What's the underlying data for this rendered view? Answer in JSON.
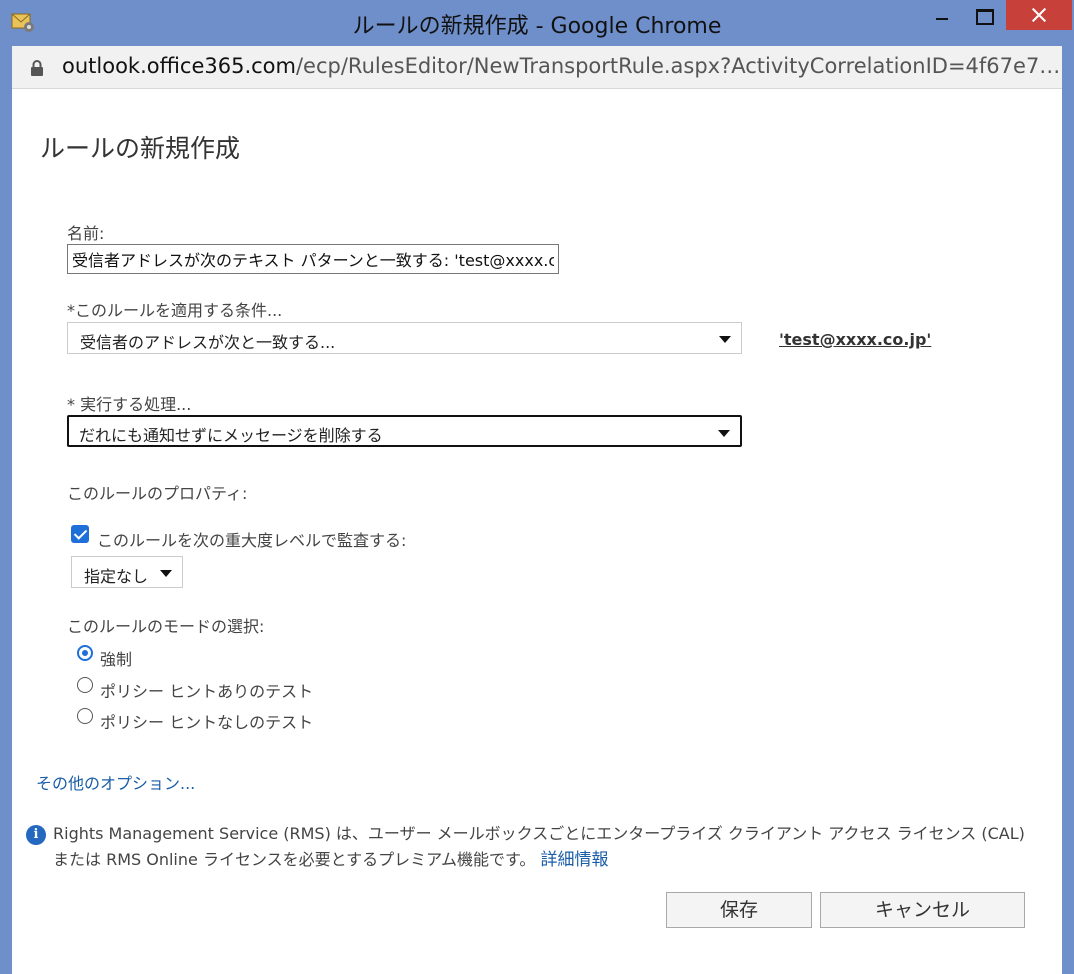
{
  "window": {
    "title": "ルールの新規作成 - Google Chrome"
  },
  "address": {
    "host": "outlook.office365.com",
    "path": "/ecp/RulesEditor/NewTransportRule.aspx?ActivityCorrelationID=4f67e7…"
  },
  "page": {
    "title": "ルールの新規作成"
  },
  "form": {
    "name_label": "名前:",
    "name_value": "受信者アドレスが次のテキスト パターンと一致する: 'test@xxxx.co.jp'",
    "condition_label": "*このルールを適用する条件...",
    "condition_value": "受信者のアドレスが次と一致する...",
    "condition_link": "'test@xxxx.co.jp'",
    "action_label": "* 実行する処理...",
    "action_value": "だれにも通知せずにメッセージを削除する",
    "properties_label": "このルールのプロパティ:",
    "audit_label": "このルールを次の重大度レベルで監査する:",
    "audit_checked": true,
    "severity_value": "指定なし",
    "mode_label": "このルールのモードの選択:",
    "modes": [
      {
        "label": "強制",
        "selected": true
      },
      {
        "label": "ポリシー ヒントありのテスト",
        "selected": false
      },
      {
        "label": "ポリシー ヒントなしのテスト",
        "selected": false
      }
    ],
    "more_options": "その他のオプション..."
  },
  "info": {
    "text": "Rights Management Service (RMS) は、ユーザー メールボックスごとにエンタープライズ クライアント アクセス ライセンス (CAL) または RMS Online ライセンスを必要とするプレミアム機能です。",
    "more_link": "詳細情報"
  },
  "buttons": {
    "save": "保存",
    "cancel": "キャンセル"
  },
  "colors": {
    "frame": "#6f8fcb",
    "close": "#c8403a",
    "accent": "#1e6fd9",
    "link": "#1a5ea8"
  }
}
